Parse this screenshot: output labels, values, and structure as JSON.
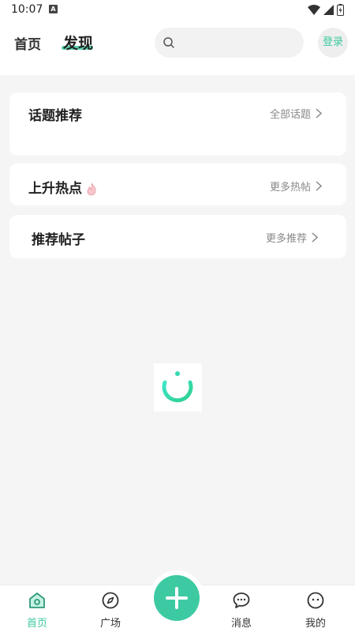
{
  "status_bar": {
    "time": "10:07",
    "notification_letter": "A"
  },
  "header": {
    "tabs": [
      {
        "label": "首页"
      },
      {
        "label": "发现"
      }
    ],
    "login_label": "登录"
  },
  "sections": [
    {
      "title": "话题推荐",
      "more": "全部话题"
    },
    {
      "title": "上升热点",
      "more": "更多热帖"
    },
    {
      "title": "推荐帖子",
      "more": "更多推荐"
    }
  ],
  "bottom_nav": {
    "items": [
      {
        "label": "首页"
      },
      {
        "label": "广场"
      },
      {
        "label": "消息"
      },
      {
        "label": "我的"
      }
    ]
  },
  "colors": {
    "accent": "#3dcaa2",
    "background": "#f5f5f5"
  }
}
